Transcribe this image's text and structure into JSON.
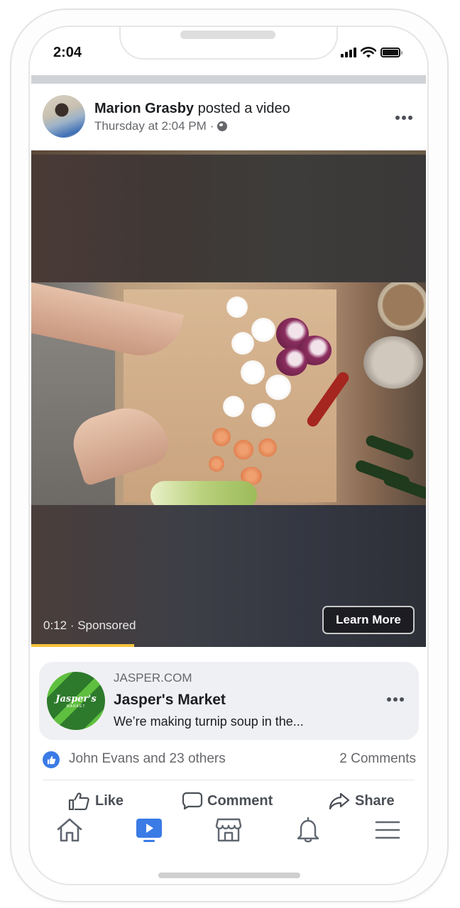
{
  "status_bar": {
    "time": "2:04"
  },
  "post": {
    "author": "Marion Grasby",
    "action": " posted a video",
    "timestamp": "Thursday at 2:04 PM",
    "separator": "·",
    "privacy_icon": "globe-icon",
    "more_icon": "more-dots-icon"
  },
  "video": {
    "elapsed": "0:12",
    "label": " · Sponsored",
    "cta_label": "Learn More",
    "progress_percent": 26,
    "progress_color": "#f5c33b"
  },
  "link_card": {
    "domain": "JASPER.COM",
    "title": "Jasper's Market",
    "description": "We’re making turnip soup in the...",
    "logo_text": "Jasper's",
    "logo_subtext": "MARKET"
  },
  "reactions": {
    "summary": "John Evans and 23 others",
    "comments": "2 Comments",
    "like_color": "#3b7be6"
  },
  "actions": [
    {
      "label": "Like",
      "icon": "thumbs-up-icon"
    },
    {
      "label": "Comment",
      "icon": "comment-icon"
    },
    {
      "label": "Share",
      "icon": "share-icon"
    }
  ],
  "tabbar": {
    "items": [
      {
        "name": "home",
        "icon": "home-icon",
        "active": false
      },
      {
        "name": "watch",
        "icon": "watch-icon",
        "active": true
      },
      {
        "name": "marketplace",
        "icon": "marketplace-icon",
        "active": false
      },
      {
        "name": "notifications",
        "icon": "bell-icon",
        "active": false
      },
      {
        "name": "menu",
        "icon": "menu-icon",
        "active": false
      }
    ],
    "active_color": "#3b7be6"
  }
}
